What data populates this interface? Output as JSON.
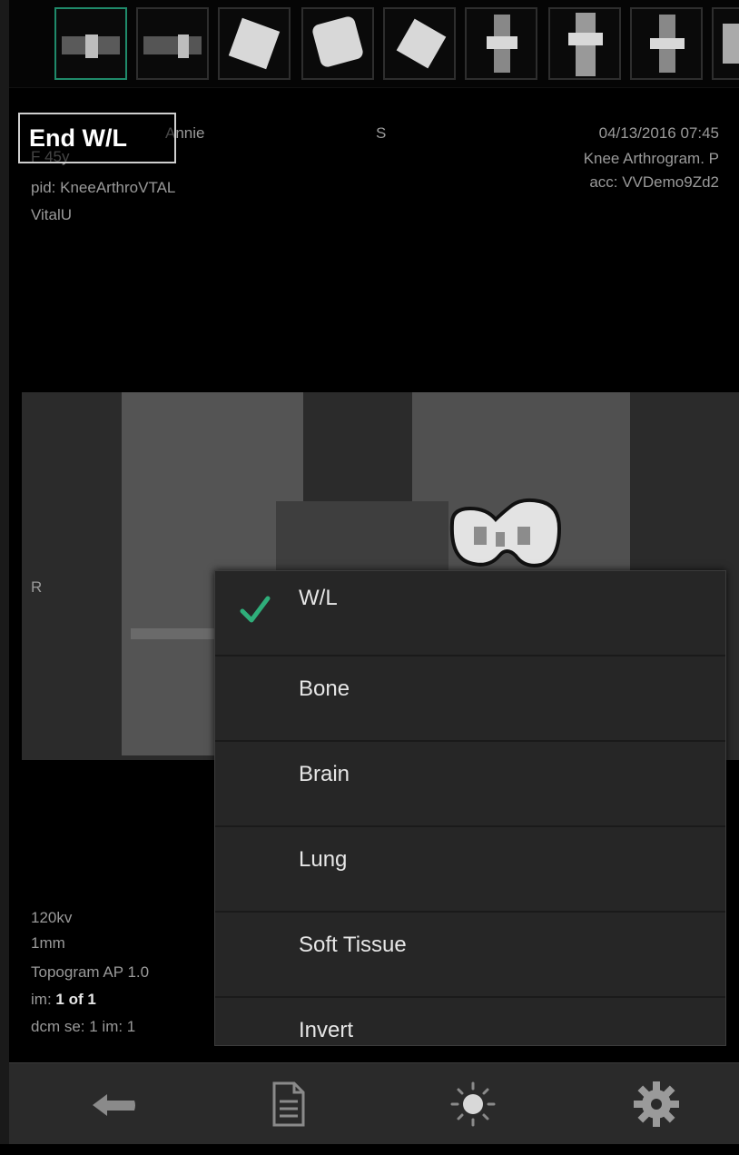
{
  "end_button": {
    "label": "End W/L"
  },
  "overlay": {
    "top_left": {
      "name_fragment": "Annie",
      "sex_age": "F 45y",
      "pid": "pid: KneeArthroVTAL",
      "institution": "VitalU"
    },
    "top_center": {
      "orientation": "S"
    },
    "top_right": {
      "datetime": "04/13/2016 07:45",
      "study": "Knee Arthrogram. P",
      "accession": "acc: VVDemo9Zd2"
    },
    "left_marker": "R",
    "bottom_left": {
      "kv": "120kv",
      "thickness": "1mm",
      "series": "Topogram AP  1.0",
      "image_prefix": "im:",
      "image_value": "1 of 1",
      "dcm": "dcm se: 1 im: 1"
    }
  },
  "wl_menu": {
    "items": [
      {
        "label": "W/L",
        "selected": true
      },
      {
        "label": "Bone",
        "selected": false
      },
      {
        "label": "Brain",
        "selected": false
      },
      {
        "label": "Lung",
        "selected": false
      },
      {
        "label": "Soft Tissue",
        "selected": false
      },
      {
        "label": "Invert",
        "selected": false
      }
    ]
  },
  "toolbar": {
    "icons": [
      "back-arrow-icon",
      "document-icon",
      "brightness-icon",
      "gear-icon"
    ]
  },
  "colors": {
    "accent_check": "#2fae7a",
    "thumb_selected": "#1f8a6a",
    "menu_bg": "#262626"
  }
}
